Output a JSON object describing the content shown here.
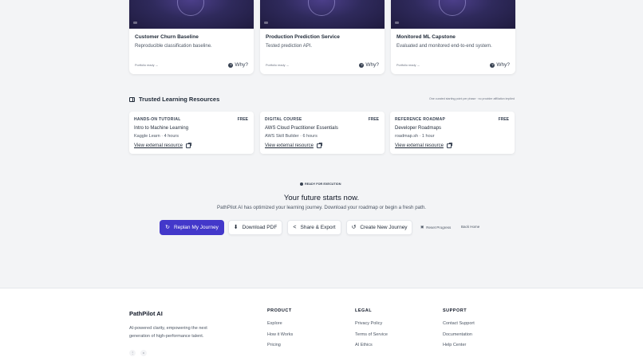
{
  "projects": [
    {
      "title": "Customer Churn Baseline",
      "desc": "Reproducible classification baseline.",
      "ready": "Portfolio ready →",
      "why": "Why?"
    },
    {
      "title": "Production Prediction Service",
      "desc": "Tested prediction API.",
      "ready": "Portfolio ready →",
      "why": "Why?"
    },
    {
      "title": "Monitored ML Capstone",
      "desc": "Evaluated and monitored end-to-end system.",
      "ready": "Portfolio ready →",
      "why": "Why?"
    }
  ],
  "resources_section": {
    "title": "Trusted Learning Resources",
    "note": "One curated starting point per phase · no provider affiliation implied",
    "items": [
      {
        "type": "HANDS-ON TUTORIAL",
        "badge": "FREE",
        "name": "Intro to Machine Learning",
        "meta": "Kaggle Learn · 4 hours",
        "link": "View external resource"
      },
      {
        "type": "DIGITAL COURSE",
        "badge": "FREE",
        "name": "AWS Cloud Practitioner Essentials",
        "meta": "AWS Skill Builder · 6 hours",
        "link": "View external resource"
      },
      {
        "type": "REFERENCE ROADMAP",
        "badge": "FREE",
        "name": "Developer Roadmaps",
        "meta": "roadmap.sh · 1 hour",
        "link": "View external resource"
      }
    ]
  },
  "cta": {
    "pill": "READY FOR EXECUTION",
    "title": "Your future starts now.",
    "subtitle": "PathPilot AI has optimized your learning journey. Download your roadmap or begin a fresh path.",
    "replan": "Replan My Journey",
    "download": "Download PDF",
    "share": "Share & Export",
    "create": "Create New Journey",
    "reset": "Reset Progress",
    "back": "Back Home"
  },
  "footer": {
    "brand": "PathPilot AI",
    "tagline": "AI-powered clarity, empowering the next generation of high-performance talent.",
    "product": {
      "heading": "PRODUCT",
      "links": [
        "Explore",
        "How it Works",
        "Pricing"
      ]
    },
    "legal": {
      "heading": "LEGAL",
      "links": [
        "Privacy Policy",
        "Terms of Service",
        "AI Ethics"
      ]
    },
    "support": {
      "heading": "SUPPORT",
      "links": [
        "Contact Support",
        "Documentation",
        "Help Center"
      ]
    }
  }
}
